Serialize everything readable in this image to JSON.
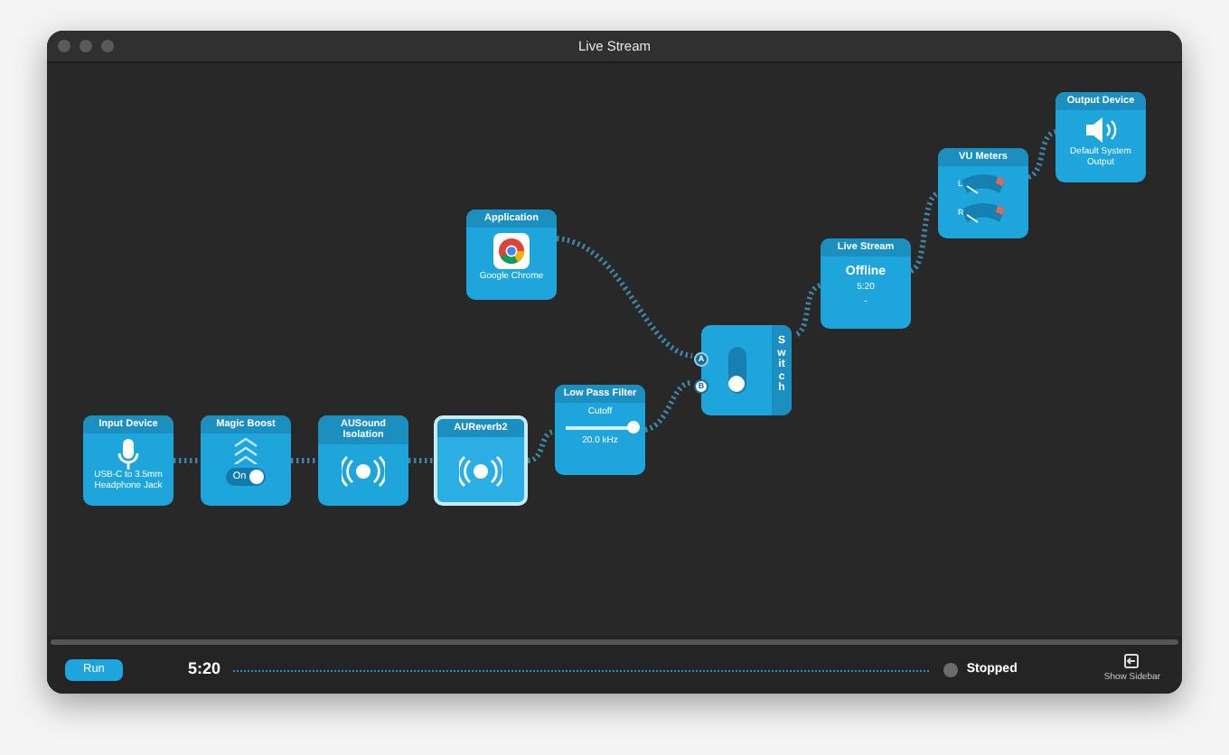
{
  "window": {
    "title": "Live Stream"
  },
  "nodes": [
    {
      "kind": "device",
      "title": "Input Device",
      "caption": "USB-C to 3.5mm Headphone Jack",
      "selected": false
    },
    {
      "kind": "toggle",
      "title": "Magic Boost",
      "toggle_label": "On",
      "on": true,
      "selected": false
    },
    {
      "kind": "plugin",
      "title": "AUSound Isolation",
      "selected": false
    },
    {
      "kind": "plugin",
      "title": "AUReverb2",
      "selected": true
    },
    {
      "kind": "slider",
      "title": "Low Pass Filter",
      "param": "Cutoff",
      "level": 1.0,
      "reading": "20.0 kHz",
      "selected": false
    },
    {
      "kind": "app",
      "title": "Application",
      "caption": "Google Chrome",
      "selected": false
    },
    {
      "kind": "switch",
      "title": "Switch",
      "inputs": [
        {
          "label": "A",
          "selected": false
        },
        {
          "label": "B",
          "selected": true
        }
      ],
      "selected": false
    },
    {
      "kind": "stream",
      "title": "Live Stream",
      "status": "Offline",
      "time": "5:20",
      "detail": "-",
      "selected": false
    },
    {
      "kind": "meters",
      "title": "VU Meters",
      "channels": [
        "L",
        "R"
      ],
      "selected": false
    },
    {
      "kind": "output",
      "title": "Output Device",
      "caption": "Default System Output",
      "selected": false
    }
  ],
  "bottom_bar": {
    "run_button": "Run",
    "time": "5:20",
    "status": "Stopped",
    "sidebar_button": "Show Sidebar"
  }
}
